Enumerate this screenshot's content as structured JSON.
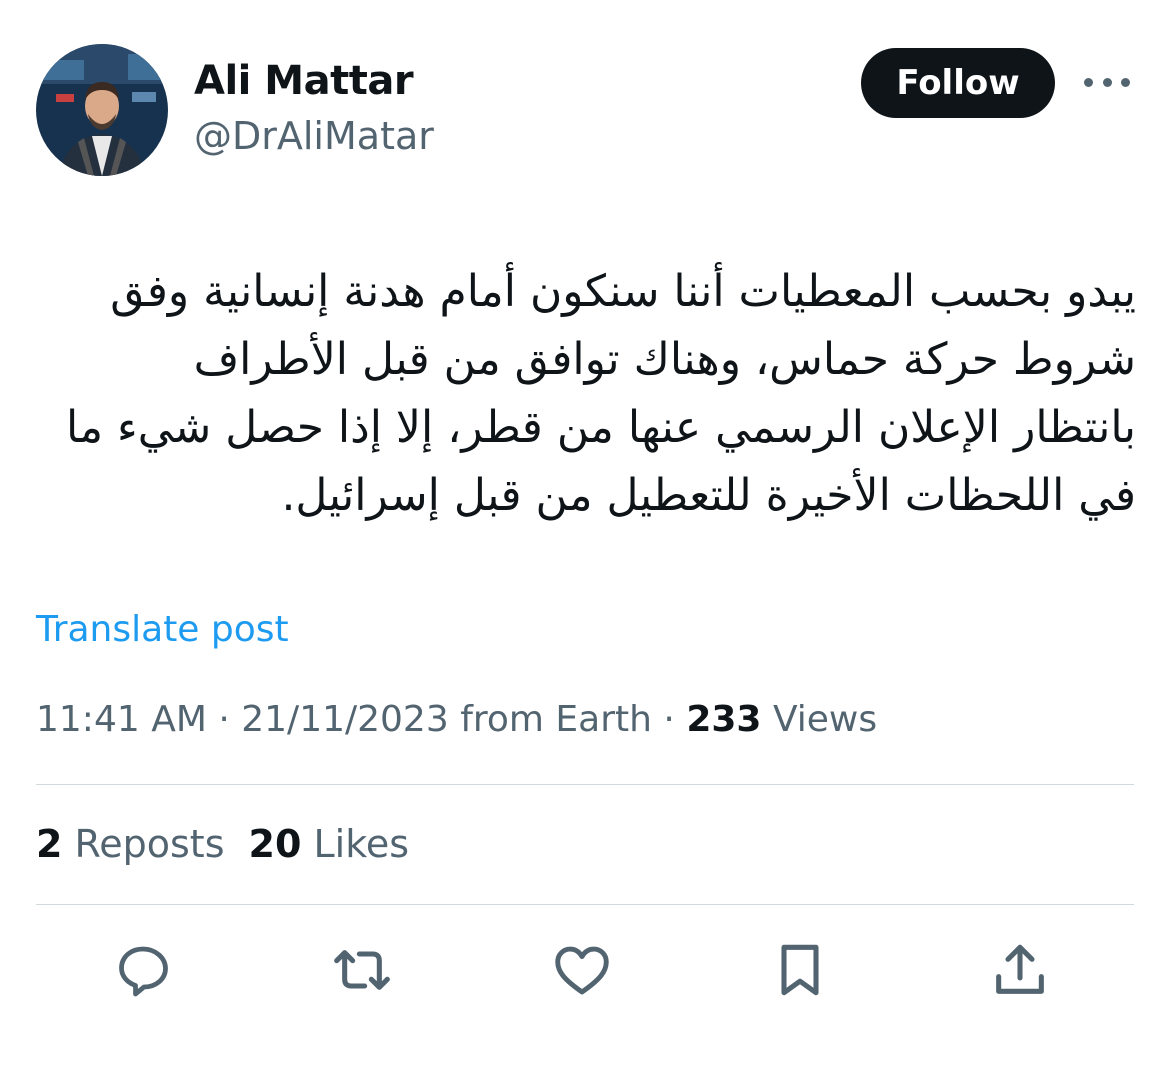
{
  "author": {
    "display_name": "Ali Mattar",
    "handle": "@DrAliMatar",
    "avatar_icon": "profile-photo"
  },
  "follow_label": "Follow",
  "tweet": {
    "lines": [
      "يبدو بحسب المعطيات أننا سنكون أمام هدنة إنسانية وفق",
      "شروط حركة حماس، وهناك توافق من قبل الأطراف",
      "بانتظار الإعلان الرسمي عنها من قطر، إلا إذا حصل شيء ما",
      "في اللحظات الأخيرة للتعطيل من قبل إسرائيل."
    ]
  },
  "translate_label": "Translate post",
  "meta": {
    "time": "11:41 AM",
    "separator": "·",
    "date": "21/11/2023",
    "source": "from Earth",
    "views_count": "233",
    "views_label": "Views"
  },
  "stats": {
    "reposts_count": "2",
    "reposts_label": "Reposts",
    "likes_count": "20",
    "likes_label": "Likes"
  },
  "actions": [
    "reply-icon",
    "repost-icon",
    "like-icon",
    "bookmark-icon",
    "share-icon"
  ],
  "colors": {
    "text": "#0f1419",
    "secondary": "#536471",
    "link": "#1d9bf0",
    "divider": "#cfd9de",
    "follow_bg": "#0f1419"
  }
}
